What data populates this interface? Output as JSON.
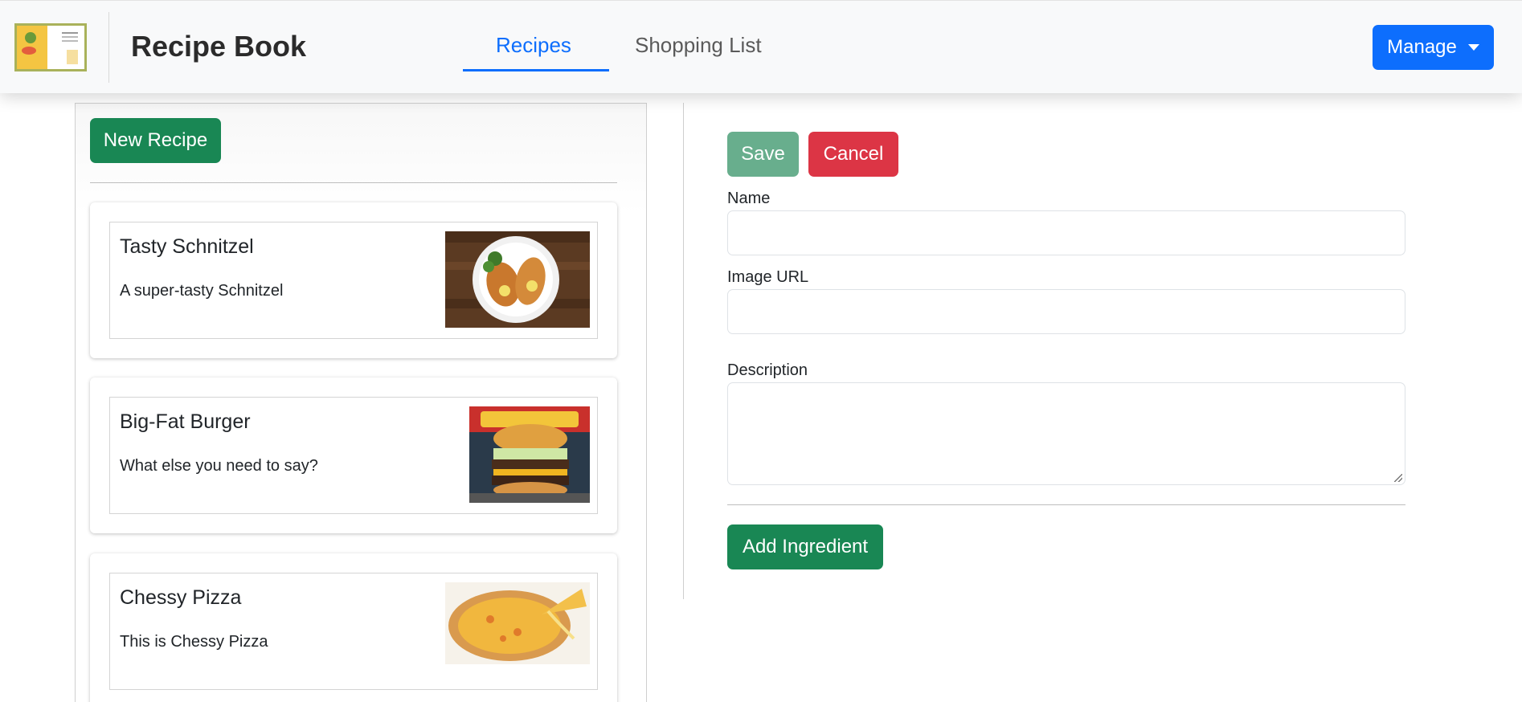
{
  "header": {
    "brand": "Recipe Book",
    "tabs": [
      {
        "label": "Recipes",
        "active": true
      },
      {
        "label": "Shopping List",
        "active": false
      }
    ],
    "manage_label": "Manage",
    "logo_icon": "recipe-book-cover-icon"
  },
  "recipes": {
    "new_button": "New Recipe",
    "items": [
      {
        "name": "Tasty Schnitzel",
        "description": "A super-tasty Schnitzel",
        "image": "schnitzel-plate"
      },
      {
        "name": "Big-Fat Burger",
        "description": "What else you need to say?",
        "image": "fatburger-burger"
      },
      {
        "name": "Chessy Pizza",
        "description": "This is Chessy Pizza",
        "image": "cheese-pizza"
      }
    ]
  },
  "form": {
    "save_label": "Save",
    "cancel_label": "Cancel",
    "name_label": "Name",
    "name_value": "",
    "image_url_label": "Image URL",
    "image_url_value": "",
    "description_label": "Description",
    "description_value": "",
    "add_ingredient_label": "Add Ingredient"
  },
  "colors": {
    "primary": "#0d6efd",
    "success": "#198754",
    "success_disabled": "#68ae8d",
    "danger": "#dc3545",
    "navbar_bg": "#f8f9fa"
  }
}
